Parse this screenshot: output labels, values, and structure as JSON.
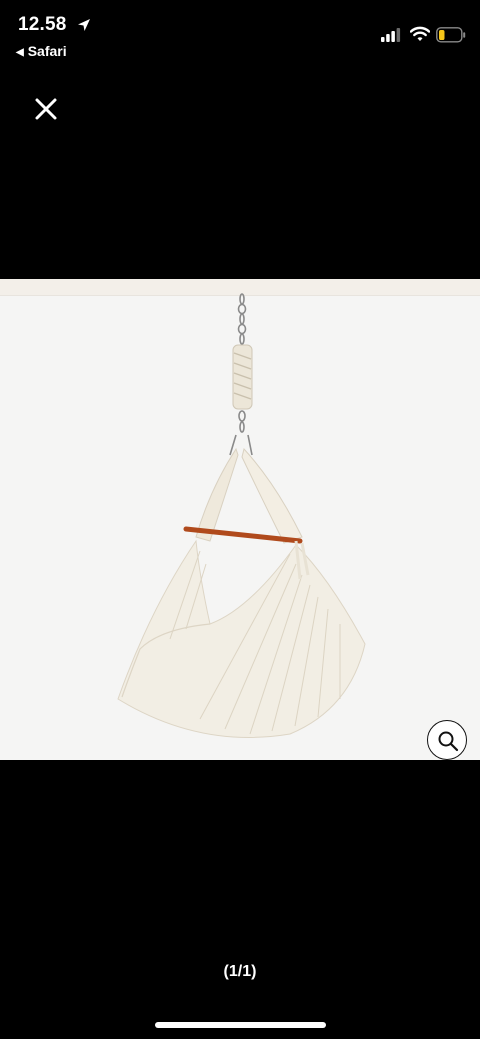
{
  "status_bar": {
    "time": "12.58",
    "back_app": "Safari",
    "icons": [
      "location-arrow-icon",
      "cellular-signal-icon",
      "wifi-icon",
      "battery-icon"
    ],
    "battery_color": "#f5c518"
  },
  "viewer": {
    "close_icon": "close-icon",
    "zoom_icon": "magnifier-icon",
    "page_counter": "(1/1)"
  },
  "colors": {
    "background": "#000000",
    "image_bg": "#f5f5f4",
    "fabric": "#f2eee4",
    "spreader_bar": "#b04a1c"
  }
}
